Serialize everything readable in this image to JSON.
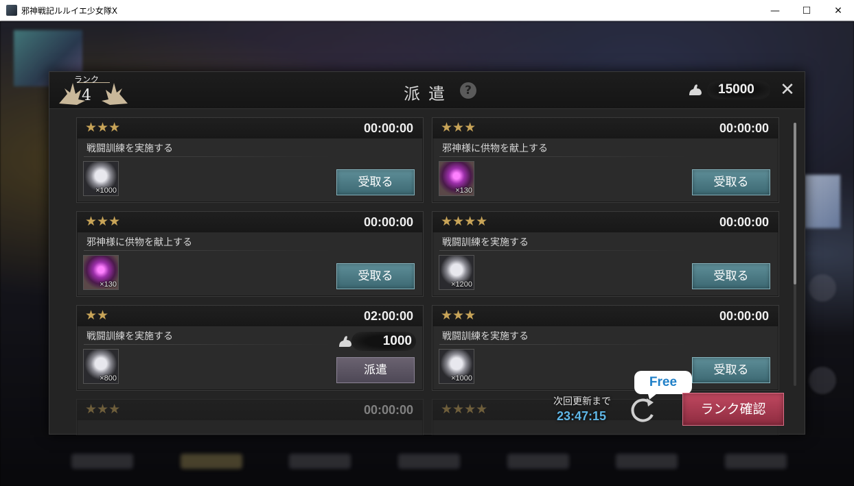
{
  "window": {
    "title": "邪神戦記ルルイエ少女隊X",
    "minimize": "—",
    "maximize": "☐",
    "close": "✕"
  },
  "dialog": {
    "rank_label": "ランク",
    "rank_value": "4",
    "title": "派遣",
    "help": "?",
    "stamina": "15000",
    "close": "✕"
  },
  "missions": [
    {
      "stars": 3,
      "star_text": "★★★",
      "timer": "00:00:00",
      "name": "戦闘訓練を実施する",
      "item": "fingerprint-icon",
      "qty": "×1000",
      "action": "受取る",
      "state": "receive"
    },
    {
      "stars": 3,
      "star_text": "★★★",
      "timer": "00:00:00",
      "name": "邪神様に供物を献上する",
      "item": "orb-icon",
      "qty": "×130",
      "action": "受取る",
      "state": "receive"
    },
    {
      "stars": 3,
      "star_text": "★★★",
      "timer": "00:00:00",
      "name": "邪神様に供物を献上する",
      "item": "orb-icon",
      "qty": "×130",
      "action": "受取る",
      "state": "receive"
    },
    {
      "stars": 4,
      "star_text": "★★★★",
      "timer": "00:00:00",
      "name": "戦闘訓練を実施する",
      "item": "fingerprint-icon",
      "qty": "×1200",
      "action": "受取る",
      "state": "receive"
    },
    {
      "stars": 2,
      "star_text": "★★",
      "timer": "02:00:00",
      "name": "戦闘訓練を実施する",
      "item": "fingerprint-icon",
      "qty": "×800",
      "cost": "1000",
      "action": "派遣",
      "state": "dispatch"
    },
    {
      "stars": 3,
      "star_text": "★★★",
      "timer": "00:00:00",
      "name": "戦闘訓練を実施する",
      "item": "fingerprint-icon",
      "qty": "×1000",
      "action": "受取る",
      "state": "receive"
    },
    {
      "stars": 3,
      "star_text": "★★★",
      "timer": "00:00:00"
    },
    {
      "stars": 4,
      "star_text": "★★★★",
      "timer": ""
    }
  ],
  "footer": {
    "refresh_label": "次回更新まで",
    "refresh_timer": "23:47:15",
    "free_badge": "Free",
    "rank_button": "ランク確認"
  },
  "colors": {
    "star": "#c8a458",
    "receive_button": "#4a7a84",
    "dispatch_button": "#5a5462",
    "rank_button": "#a83a50",
    "timer_accent": "#5fb6e6"
  }
}
